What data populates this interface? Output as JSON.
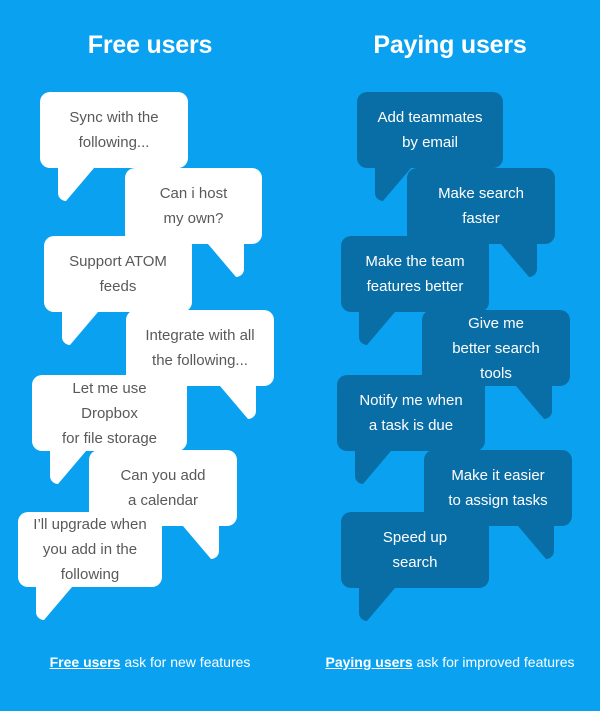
{
  "palette": {
    "background": "#0aa2f0",
    "light_bubble": "#ffffff",
    "dark_bubble": "#0a6ea6",
    "light_bubble_text": "#58595b",
    "dark_bubble_text": "#ffffff",
    "title_text": "#ffffff"
  },
  "columns": {
    "free": {
      "title": "Free users",
      "footnote_strong": "Free users",
      "footnote_rest": " ask for new features"
    },
    "paying": {
      "title": "Paying users",
      "footnote_strong": "Paying users",
      "footnote_rest": " ask for improved features"
    }
  },
  "free_bubbles": [
    {
      "text": "Sync with the\nfollowing..."
    },
    {
      "text": "Can i host\nmy own?"
    },
    {
      "text": "Support ATOM\nfeeds"
    },
    {
      "text": "Integrate with all\nthe following..."
    },
    {
      "text": "Let me use Dropbox\nfor file storage"
    },
    {
      "text": "Can you add\na calendar"
    },
    {
      "text": "I’ll upgrade when\nyou add in the\nfollowing"
    }
  ],
  "paying_bubbles": [
    {
      "text": "Add teammates\nby email"
    },
    {
      "text": "Make search\nfaster"
    },
    {
      "text": "Make the team\nfeatures better"
    },
    {
      "text": "Give me\nbetter search tools"
    },
    {
      "text": "Notify me when\na task is due"
    },
    {
      "text": "Make it easier\nto assign tasks"
    },
    {
      "text": "Speed up\nsearch"
    }
  ]
}
